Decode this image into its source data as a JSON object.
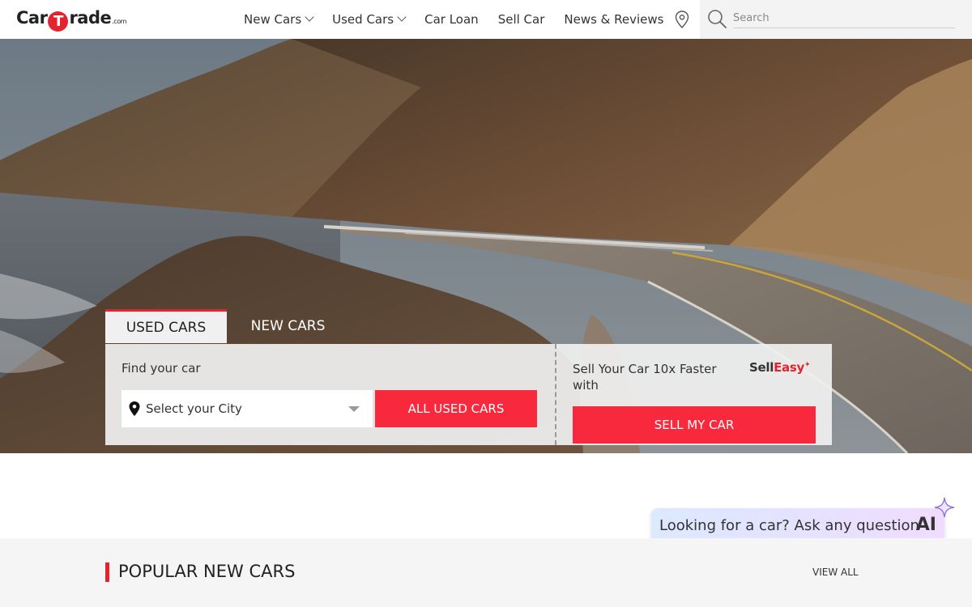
{
  "brand": {
    "logo_left": "Car",
    "logo_mid": "T",
    "logo_right": "rade",
    "logo_suffix": ".com",
    "accent_color": "#e4232f",
    "button_color": "#f8283d"
  },
  "nav": {
    "items": [
      {
        "label": "New Cars",
        "has_dropdown": true
      },
      {
        "label": "Used Cars",
        "has_dropdown": true
      },
      {
        "label": "Car Loan",
        "has_dropdown": false
      },
      {
        "label": "Sell Car",
        "has_dropdown": false
      },
      {
        "label": "News & Reviews",
        "has_dropdown": false
      }
    ],
    "location_icon": "location-pin-icon"
  },
  "search": {
    "placeholder": "Search",
    "value": "",
    "icon": "search-icon"
  },
  "hero": {
    "tabs": [
      {
        "label": "USED CARS",
        "active": true
      },
      {
        "label": "NEW CARS",
        "active": false
      }
    ],
    "find_label": "Find your car",
    "city_placeholder": "Select your City",
    "all_used_label": "ALL USED CARS",
    "sell_label": "Sell Your Car 10x Faster with",
    "selleasy_sell": "Sell",
    "selleasy_easy": "Easy",
    "sell_button": "SELL MY CAR"
  },
  "assistant": {
    "prompt": "Looking for a car? Ask any question",
    "badge": "AI"
  },
  "popular": {
    "title": "POPULAR NEW CARS",
    "view_all": "VIEW ALL"
  }
}
